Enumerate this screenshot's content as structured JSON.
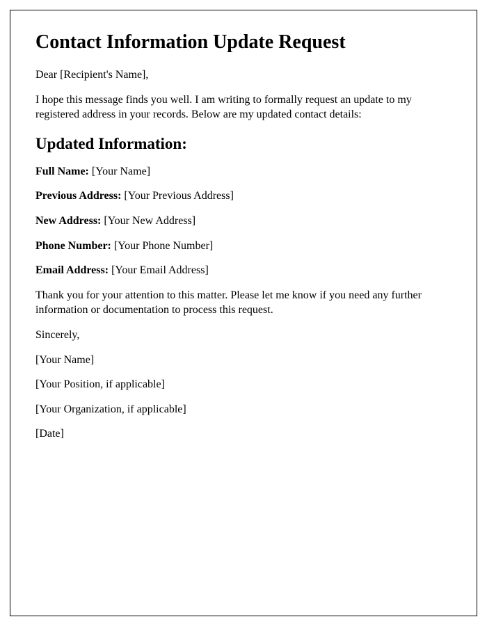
{
  "title": "Contact Information Update Request",
  "salutation": "Dear [Recipient's Name],",
  "intro": "I hope this message finds you well. I am writing to formally request an update to my registered address in your records. Below are my updated contact details:",
  "section_heading": "Updated Information:",
  "fields": {
    "full_name": {
      "label": "Full Name:",
      "value": " [Your Name]"
    },
    "previous_address": {
      "label": "Previous Address:",
      "value": " [Your Previous Address]"
    },
    "new_address": {
      "label": "New Address:",
      "value": " [Your New Address]"
    },
    "phone_number": {
      "label": "Phone Number:",
      "value": " [Your Phone Number]"
    },
    "email_address": {
      "label": "Email Address:",
      "value": " [Your Email Address]"
    }
  },
  "thank_you": "Thank you for your attention to this matter. Please let me know if you need any further information or documentation to process this request.",
  "closing": "Sincerely,",
  "signature": {
    "name": "[Your Name]",
    "position": "[Your Position, if applicable]",
    "organization": "[Your Organization, if applicable]",
    "date": "[Date]"
  }
}
